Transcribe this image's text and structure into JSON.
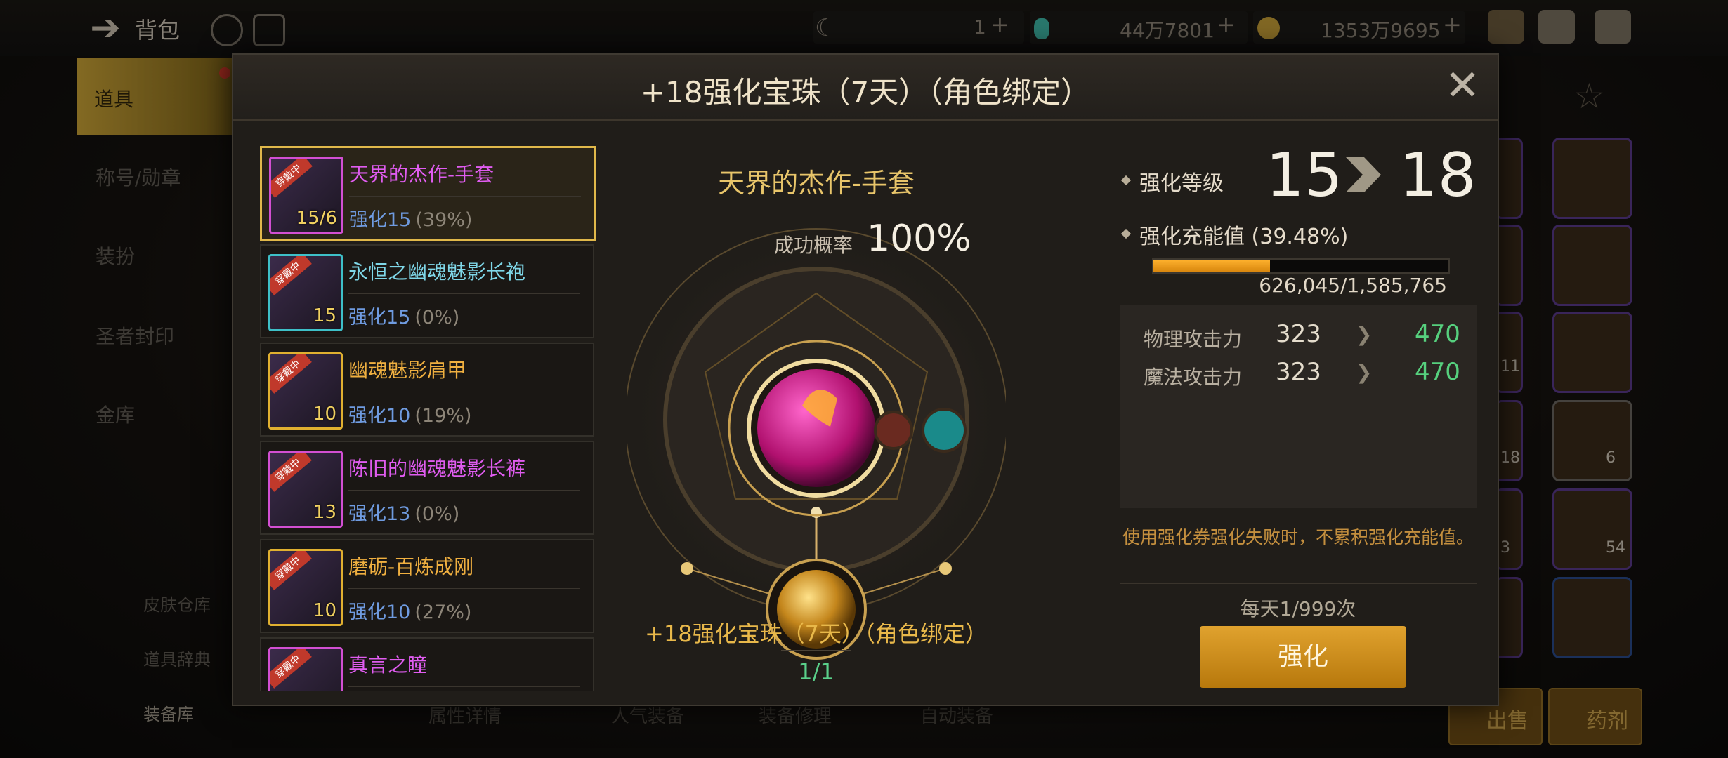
{
  "topbar": {
    "title": "背包",
    "currency1": "1",
    "currency2": "44万7801",
    "currency3": "1353万9695"
  },
  "sidebar": {
    "items": [
      "道具",
      "称号/勋章",
      "装扮",
      "圣者封印",
      "金库"
    ],
    "bottom": [
      "皮肤仓库",
      "道具辞典",
      "装备库"
    ]
  },
  "bottom_tabs": [
    "属性详情",
    "人气装备",
    "装备修理",
    "自动装备"
  ],
  "right_buttons": [
    "出售",
    "药剂"
  ],
  "inventory_counts": [
    "11",
    "18",
    "6",
    "3",
    "54"
  ],
  "modal": {
    "title": "+18强化宝珠（7天）（角色绑定）",
    "close": "✕",
    "list": [
      {
        "thumb": "15/6",
        "name": "天界的杰作-手套",
        "stat_label": "强化15",
        "stat_pct": "(39%)",
        "name_color": "#e05cf0",
        "border": "#d24fd2",
        "selected": true
      },
      {
        "thumb": "15",
        "name": "永恒之幽魂魅影长袍",
        "stat_label": "强化15",
        "stat_pct": "(0%)",
        "name_color": "#7fd7e8",
        "border": "#3ec0c8",
        "selected": false
      },
      {
        "thumb": "10",
        "name": "幽魂魅影肩甲",
        "stat_label": "强化10",
        "stat_pct": "(19%)",
        "name_color": "#f0b040",
        "border": "#e0b030",
        "selected": false
      },
      {
        "thumb": "13",
        "name": "陈旧的幽魂魅影长裤",
        "stat_label": "强化13",
        "stat_pct": "(0%)",
        "name_color": "#e05cf0",
        "border": "#d24fd2",
        "selected": false
      },
      {
        "thumb": "10",
        "name": "磨砺-百炼成刚",
        "stat_label": "强化10",
        "stat_pct": "(27%)",
        "name_color": "#f0b040",
        "border": "#e0b030",
        "selected": false
      },
      {
        "thumb": "",
        "name": "真言之瞳",
        "stat_label": "",
        "stat_pct": "",
        "name_color": "#e05cf0",
        "border": "#d24fd2",
        "selected": false
      }
    ],
    "ribbon": "穿戴中",
    "center": {
      "item_name": "天界的杰作-手套",
      "rate_label": "成功概率",
      "rate": "100%",
      "orb_name": "+18强化宝珠（7天）（角色绑定）",
      "count": "1/1"
    },
    "right": {
      "level_label": "强化等级",
      "level_from": "15",
      "level_to": "18",
      "charge_label": "强化充能值 (39.48%)",
      "charge_fraction": 0.3948,
      "charge_value": "626,045/1,585,765",
      "stats": [
        {
          "label": "物理攻击力",
          "from": "323",
          "to": "470"
        },
        {
          "label": "魔法攻击力",
          "from": "323",
          "to": "470"
        }
      ],
      "note": "使用强化券强化失败时，不累积强化充能值。",
      "daily": "每天1/999次",
      "button": "强化"
    }
  }
}
